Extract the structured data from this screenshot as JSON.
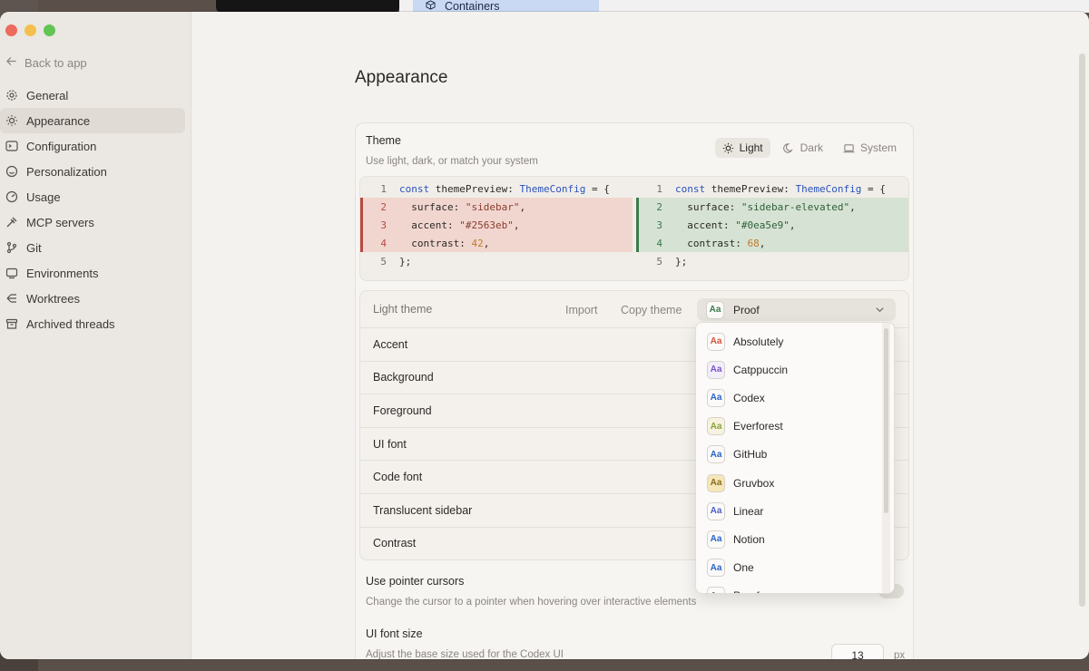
{
  "background": {
    "tab_label": "Containers"
  },
  "sidebar": {
    "back_label": "Back to app",
    "items": [
      {
        "label": "General",
        "icon": "gear-icon"
      },
      {
        "label": "Appearance",
        "icon": "sun-icon",
        "active": true
      },
      {
        "label": "Configuration",
        "icon": "terminal-icon"
      },
      {
        "label": "Personalization",
        "icon": "smile-icon"
      },
      {
        "label": "Usage",
        "icon": "gauge-icon"
      },
      {
        "label": "MCP servers",
        "icon": "plug-icon"
      },
      {
        "label": "Git",
        "icon": "git-branch-icon"
      },
      {
        "label": "Environments",
        "icon": "monitor-icon"
      },
      {
        "label": "Worktrees",
        "icon": "worktree-icon"
      },
      {
        "label": "Archived threads",
        "icon": "archive-icon"
      }
    ]
  },
  "page": {
    "title": "Appearance",
    "theme": {
      "title": "Theme",
      "subtitle": "Use light, dark, or match your system",
      "options": [
        {
          "label": "Light",
          "icon": "sun-icon",
          "active": true
        },
        {
          "label": "Dark",
          "icon": "moon-icon"
        },
        {
          "label": "System",
          "icon": "laptop-icon"
        }
      ]
    },
    "diff": {
      "left": [
        {
          "n": "1",
          "kind": "plain",
          "parts": [
            [
              "kw",
              "const "
            ],
            [
              "",
              "themePreview: "
            ],
            [
              "tp",
              "ThemeConfig"
            ],
            [
              "",
              " = {"
            ]
          ]
        },
        {
          "n": "2",
          "kind": "chg",
          "parts": [
            [
              "",
              "  surface: "
            ],
            [
              "st",
              "\"sidebar\""
            ],
            [
              "",
              ","
            ]
          ]
        },
        {
          "n": "3",
          "kind": "chg",
          "parts": [
            [
              "",
              "  accent: "
            ],
            [
              "st",
              "\"#2563eb\""
            ],
            [
              "",
              ","
            ]
          ]
        },
        {
          "n": "4",
          "kind": "chg",
          "parts": [
            [
              "",
              "  contrast: "
            ],
            [
              "nm",
              "42"
            ],
            [
              "",
              ","
            ]
          ]
        },
        {
          "n": "5",
          "kind": "plain",
          "parts": [
            [
              "",
              "};"
            ]
          ]
        }
      ],
      "right": [
        {
          "n": "1",
          "kind": "plain",
          "parts": [
            [
              "kw",
              "const "
            ],
            [
              "",
              "themePreview: "
            ],
            [
              "tp",
              "ThemeConfig"
            ],
            [
              "",
              " = {"
            ]
          ]
        },
        {
          "n": "2",
          "kind": "chg",
          "parts": [
            [
              "",
              "  surface: "
            ],
            [
              "st",
              "\"sidebar-elevated\""
            ],
            [
              "",
              ","
            ]
          ]
        },
        {
          "n": "3",
          "kind": "chg",
          "parts": [
            [
              "",
              "  accent: "
            ],
            [
              "st",
              "\"#0ea5e9\""
            ],
            [
              "",
              ","
            ]
          ]
        },
        {
          "n": "4",
          "kind": "chg",
          "parts": [
            [
              "",
              "  contrast: "
            ],
            [
              "nm",
              "68"
            ],
            [
              "",
              ","
            ]
          ]
        },
        {
          "n": "5",
          "kind": "plain",
          "parts": [
            [
              "",
              "};"
            ]
          ]
        }
      ]
    },
    "light_theme": {
      "label": "Light theme",
      "import_label": "Import",
      "copy_label": "Copy theme",
      "selected": "Proof",
      "rows": [
        "Accent",
        "Background",
        "Foreground",
        "UI font",
        "Code font",
        "Translucent sidebar",
        "Contrast"
      ]
    },
    "pointer": {
      "title": "Use pointer cursors",
      "subtitle": "Change the cursor to a pointer when hovering over interactive elements"
    },
    "font_size": {
      "title": "UI font size",
      "subtitle": "Adjust the base size used for the Codex UI",
      "value": "13",
      "unit": "px"
    }
  },
  "dropdown": {
    "items": [
      {
        "label": "Absolutely",
        "color": "#d0573f",
        "bg": "#fbfaf8"
      },
      {
        "label": "Catppuccin",
        "color": "#7b52c9",
        "bg": "#f2effa"
      },
      {
        "label": "Codex",
        "color": "#2a62c9",
        "bg": "#fbfaf8"
      },
      {
        "label": "Everforest",
        "color": "#8aa23b",
        "bg": "#f7f3df"
      },
      {
        "label": "GitHub",
        "color": "#2a62c9",
        "bg": "#fbfaf8"
      },
      {
        "label": "Gruvbox",
        "color": "#8a6b1f",
        "bg": "#f6e7b8"
      },
      {
        "label": "Linear",
        "color": "#4b5fc9",
        "bg": "#fbfaf8"
      },
      {
        "label": "Notion",
        "color": "#2a62c9",
        "bg": "#fbfaf8"
      },
      {
        "label": "One",
        "color": "#2a62c9",
        "bg": "#fbfaf8"
      },
      {
        "label": "Proof",
        "color": "#3b7a4c",
        "bg": "#fbfaf8"
      }
    ],
    "aa_text": "Aa"
  }
}
